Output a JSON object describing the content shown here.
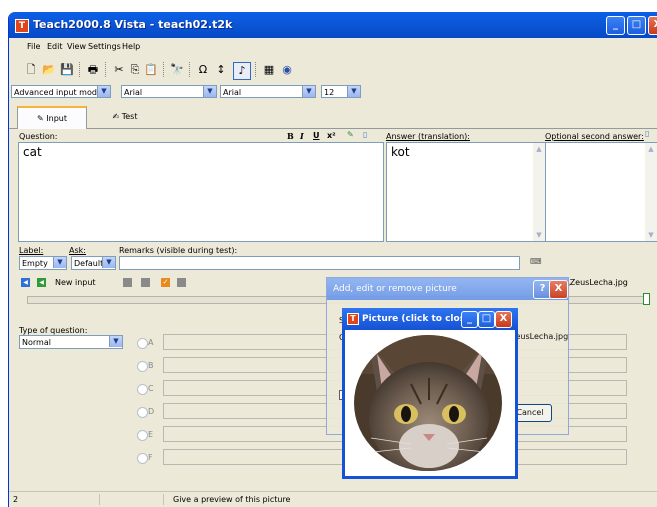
{
  "window": {
    "title": "Teach2000.8 Vista - teach02.t2k",
    "min": "_",
    "max": "□",
    "close": "X"
  },
  "menu": [
    "File",
    "Edit",
    "View",
    "Settings",
    "Help"
  ],
  "format": {
    "mode": "Advanced input mode",
    "font1": "Arial",
    "font2": "Arial",
    "size": "12",
    "bold": "B",
    "italic": "I",
    "underline": "U",
    "superscript": "x²",
    "omega": "Ω"
  },
  "tabs": [
    {
      "label": "Input"
    },
    {
      "label": "Test"
    }
  ],
  "editor": {
    "question_label": "Question:",
    "question_value": "cat",
    "answer_label": "Answer (translation):",
    "answer_value": "kot",
    "optional_label": "Optional second answer:",
    "label_label": "Label:",
    "label_value": "Empty",
    "ask_label": "Ask:",
    "ask_value": "Default",
    "remarks_label": "Remarks (visible during test):",
    "new_input": "New input",
    "type_label": "Type of question:",
    "type_value": "Normal",
    "options": [
      "A",
      "B",
      "C",
      "D",
      "E",
      "F"
    ],
    "picture_file": "\\ZeusLecha.jpg"
  },
  "dialog": {
    "title": "Add, edit or remove picture",
    "help": "?",
    "close": "X",
    "file_text": "ZeusLecha.jpg",
    "cancel": "Cancel",
    "s": "S",
    "c": "C"
  },
  "picture_window": {
    "title": "Picture (click to close)"
  },
  "status": {
    "cell1": "2",
    "hint": "Give a preview of this picture"
  },
  "colors": {
    "xp_blue": "#0a5fe8",
    "face": "#ece9d8",
    "close_red": "#c7391c"
  }
}
